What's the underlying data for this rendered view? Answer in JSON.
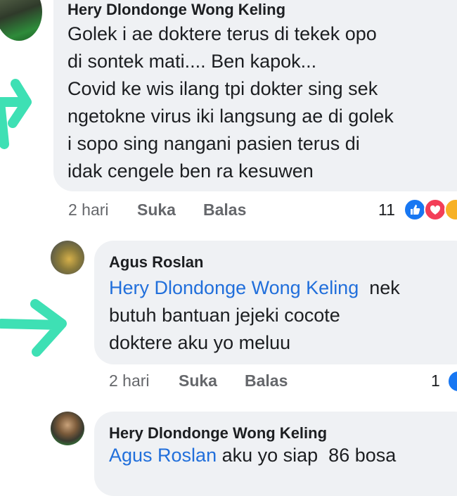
{
  "comments": [
    {
      "author": "Hery Dlondonge Wong Keling",
      "lines": [
        "Golek i ae doktere terus di tekek opo",
        "di sontek mati....  Ben kapok...",
        "Covid ke wis ilang tpi dokter sing sek",
        "ngetokne virus iki langsung ae di golek",
        "i sopo sing nangani pasien  terus di",
        "idak cengele ben ra kesuwen"
      ],
      "time": "2 hari",
      "like_label": "Suka",
      "reply_label": "Balas",
      "reaction_count": "11"
    },
    {
      "author": "Agus Roslan",
      "mention": "Hery Dlondonge Wong Keling",
      "line1_rest": "  nek",
      "lines": [
        "butuh bantuan jejeki cocote",
        "doktere aku yo meluu"
      ],
      "time": "2 hari",
      "like_label": "Suka",
      "reply_label": "Balas",
      "reaction_count": "1"
    },
    {
      "author": "Hery Dlondonge Wong Keling",
      "mention": "Agus Roslan",
      "line1_rest": " aku yo siap  86 bosa"
    }
  ],
  "colors": {
    "arrow": "#3ee0b4",
    "bubble": "#eff1f4",
    "mention": "#216fdb",
    "like": "#1877f2",
    "love": "#f33e58",
    "haha": "#f7b125"
  },
  "icons": [
    "arrow-annotation-icon",
    "like-reaction-icon",
    "love-reaction-icon",
    "haha-reaction-icon"
  ]
}
